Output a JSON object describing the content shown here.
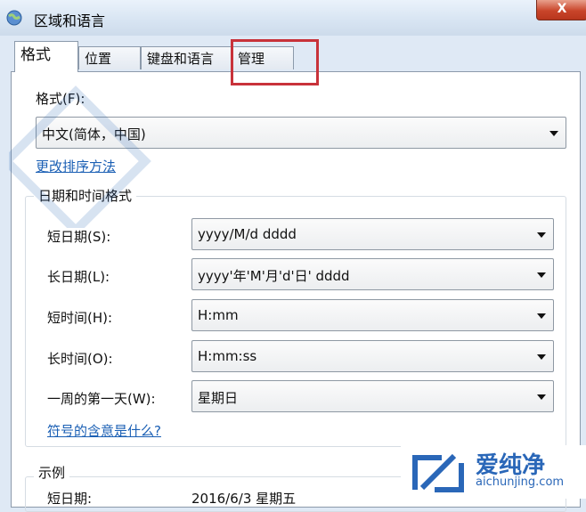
{
  "window": {
    "title": "区域和语言",
    "close_label": "X"
  },
  "tabs": [
    "格式",
    "位置",
    "键盘和语言",
    "管理"
  ],
  "format": {
    "label": "格式(F):",
    "value": "中文(简体，中国)",
    "sort_link": "更改排序方法"
  },
  "datetime": {
    "title": "日期和时间格式",
    "rows": [
      {
        "label": "短日期(S):",
        "value": "yyyy/M/d dddd"
      },
      {
        "label": "长日期(L):",
        "value": "yyyy'年'M'月'd'日' dddd"
      },
      {
        "label": "短时间(H):",
        "value": "H:mm"
      },
      {
        "label": "长时间(O):",
        "value": "H:mm:ss"
      },
      {
        "label": "一周的第一天(W):",
        "value": "星期日"
      }
    ],
    "help_link": "符号的含意是什么?"
  },
  "example": {
    "title": "示例",
    "short_date_label": "短日期:",
    "short_date_value": "2016/6/3 星期五"
  },
  "watermark": {
    "brand": "爱纯净",
    "url": "aichunjing.com",
    "color": "#2a67b8"
  },
  "colors": {
    "highlight": "#c8323a",
    "link": "#1a5fb4"
  }
}
